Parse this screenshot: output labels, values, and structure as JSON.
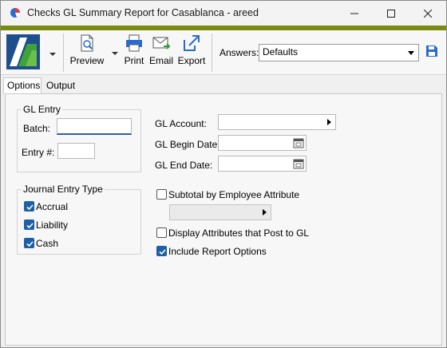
{
  "window": {
    "title": "Checks GL Summary Report for Casablanca - areed",
    "accent_color": "#7b8a13"
  },
  "toolbar": {
    "preview_label": "Preview",
    "print_label": "Print",
    "email_label": "Email",
    "export_label": "Export",
    "answers_label": "Answers:",
    "answers_value": "Defaults"
  },
  "tabs": [
    {
      "label": "Options",
      "selected": true
    },
    {
      "label": "Output",
      "selected": false
    }
  ],
  "gl_entry": {
    "title": "GL Entry",
    "batch_label": "Batch:",
    "batch_value": "",
    "entry_label": "Entry #:",
    "entry_value": ""
  },
  "journal_entry_type": {
    "title": "Journal Entry Type",
    "items": [
      {
        "label": "Accrual",
        "checked": true
      },
      {
        "label": "Liability",
        "checked": true
      },
      {
        "label": "Cash",
        "checked": true
      }
    ]
  },
  "filters": {
    "gl_account_label": "GL Account:",
    "gl_account_value": "",
    "gl_begin_date_label": "GL Begin Date:",
    "gl_begin_date_value": "",
    "gl_end_date_label": "GL End Date:",
    "gl_end_date_value": ""
  },
  "options": {
    "subtotal_label": "Subtotal by Employee Attribute",
    "subtotal_checked": false,
    "attribute_value": "",
    "display_attributes_label": "Display Attributes that Post to GL",
    "display_attributes_checked": false,
    "include_options_label": "Include Report Options",
    "include_options_checked": true
  }
}
